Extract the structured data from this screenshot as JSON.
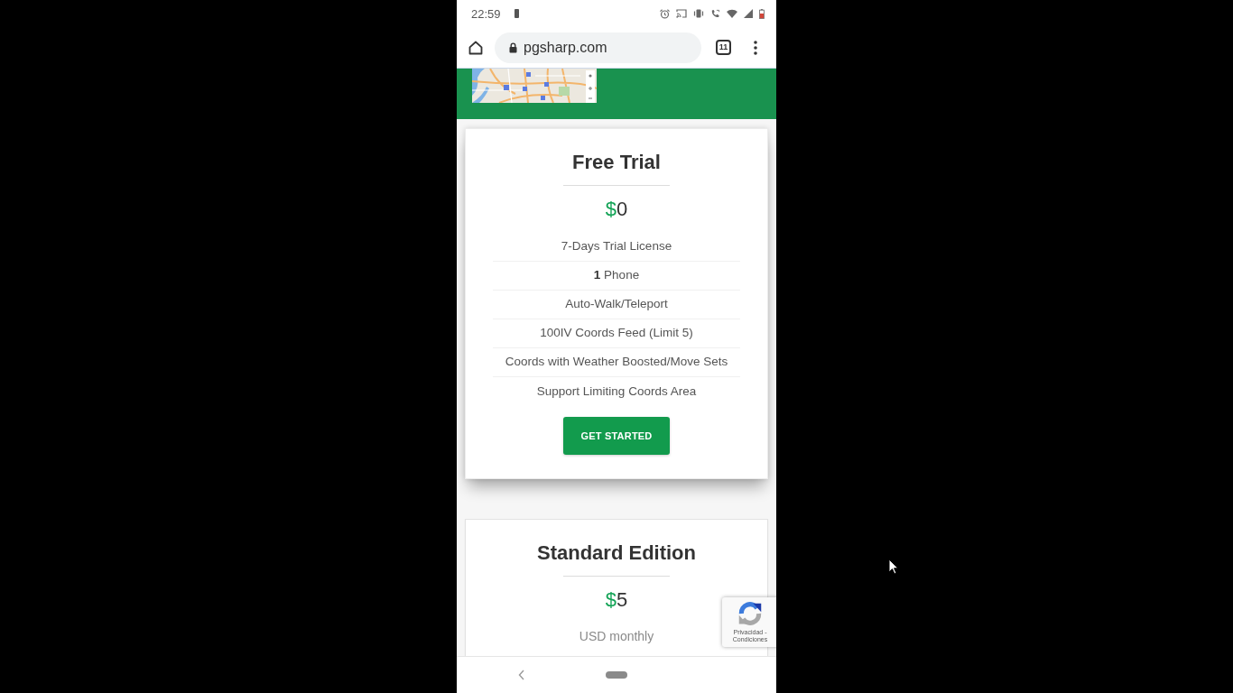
{
  "status_bar": {
    "time": "22:59"
  },
  "browser": {
    "url": "pgsharp.com",
    "tab_count": "11"
  },
  "plans": [
    {
      "title": "Free Trial",
      "raised": true,
      "currency": "$",
      "price": "0",
      "features": [
        "7-Days Trial License",
        "**1** Phone",
        "Auto-Walk/Teleport",
        "100IV Coords Feed (Limit 5)",
        "Coords with Weather Boosted/Move Sets",
        "Support Limiting Coords Area"
      ],
      "button": "GET STARTED"
    },
    {
      "title": "Standard Edition",
      "raised": false,
      "currency": "$",
      "price": "5",
      "period": "USD monthly"
    }
  ],
  "recaptcha": {
    "links": "Privacidad - Condiciones"
  }
}
